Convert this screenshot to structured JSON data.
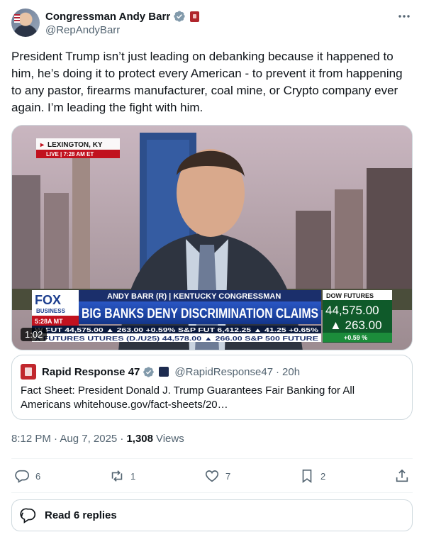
{
  "author": {
    "display_name": "Congressman Andy Barr",
    "handle": "@RepAndyBarr"
  },
  "tweet": {
    "text": "President Trump isn’t just leading on debanking because it happened to him, he’s doing it to protect every American - to prevent it from happening to any pastor, firearms manufacturer, coal mine, or Crypto company ever again. I’m leading the fight with him."
  },
  "video": {
    "duration": "1:02",
    "location": "LEXINGTON, KY",
    "live_badge": "LIVE | 7:28 AM ET",
    "network": "FOX",
    "network_sub": "BUSINESS",
    "local_time": "5:28A MT",
    "lower_third_name": "ANDY BARR (R) | KENTUCKY CONGRESSMAN",
    "headline": "BIG BANKS DENY DISCRIMINATION CLAIMS",
    "ticker_row1": "W FUT 44,575.00 ▲ 263.00 +0.59% S&P FUT 6,412.25 ▲ 41.25 +0.65%",
    "ticker_row2": "X FUTURES UTURES (D./U25) 44,578.00 ▲ 266.00 S&P 500 FUTURE",
    "dow_label": "DOW FUTURES",
    "dow_value": "44,575.00",
    "dow_change": "▲ 263.00",
    "dow_pct": "+0.59 %"
  },
  "quote": {
    "name": "Rapid Response 47",
    "handle": "@RapidResponse47",
    "separator": "·",
    "time": "20h",
    "text": "Fact Sheet: President Donald J. Trump Guarantees Fair Banking for All Americans whitehouse.gov/fact-sheets/20…"
  },
  "meta": {
    "timestamp": "8:12 PM · Aug 7, 2025 ·",
    "views_count": "1,308",
    "views_label": "Views"
  },
  "actions": {
    "replies": "6",
    "reposts": "1",
    "likes": "7",
    "bookmarks": "2"
  },
  "read_replies_label": "Read 6 replies",
  "icons": [
    "verified-icon",
    "more-icon",
    "reply-icon",
    "repost-icon",
    "like-icon",
    "bookmark-icon",
    "share-icon",
    "chat-bubble-icon"
  ],
  "colors": {
    "verified": "#829aab",
    "text_primary": "#0f1419",
    "text_secondary": "#536471",
    "border": "#cfd9de",
    "fox_blue": "#1d3f8f",
    "live_red": "#c1121f",
    "ticker_green": "#1c8c3b"
  }
}
